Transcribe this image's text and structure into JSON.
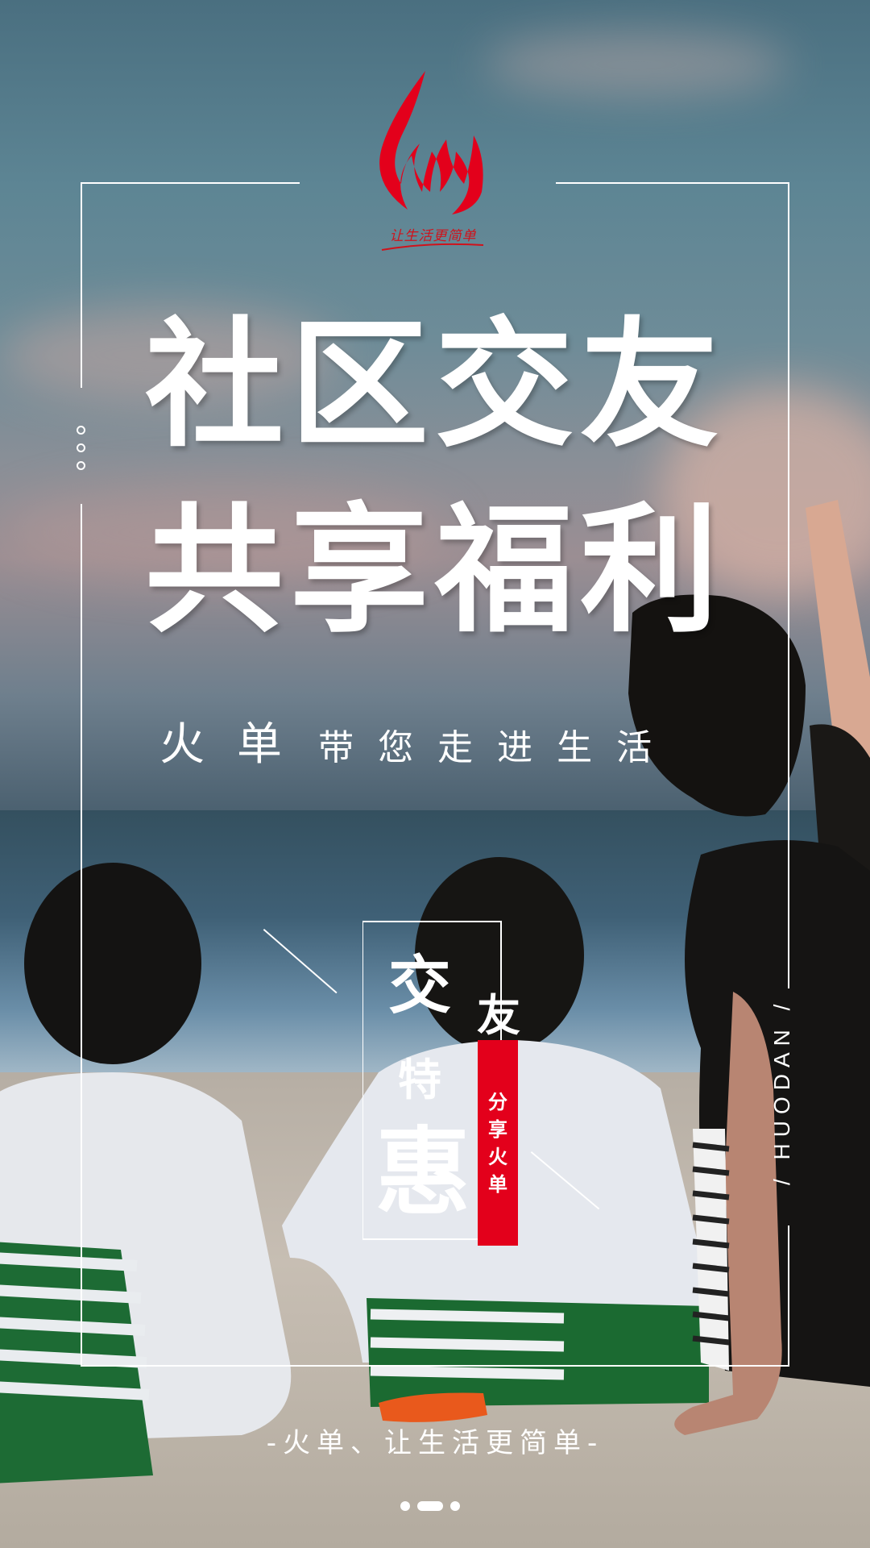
{
  "logo": {
    "caption": "让生活更简单",
    "color": "#e3001b"
  },
  "headline": {
    "line1": "社区交友",
    "line2": "共享福利"
  },
  "subline": {
    "brand": "火单",
    "text": "带您走进生活"
  },
  "promo": {
    "char1": "交",
    "char2": "友",
    "char3": "特",
    "char4": "惠",
    "tag": [
      "分",
      "享",
      "火",
      "单"
    ]
  },
  "side_label": "/ HUODAN /",
  "slogan": "-火单、让生活更简单-",
  "pager": {
    "count": 3,
    "active": 2
  }
}
